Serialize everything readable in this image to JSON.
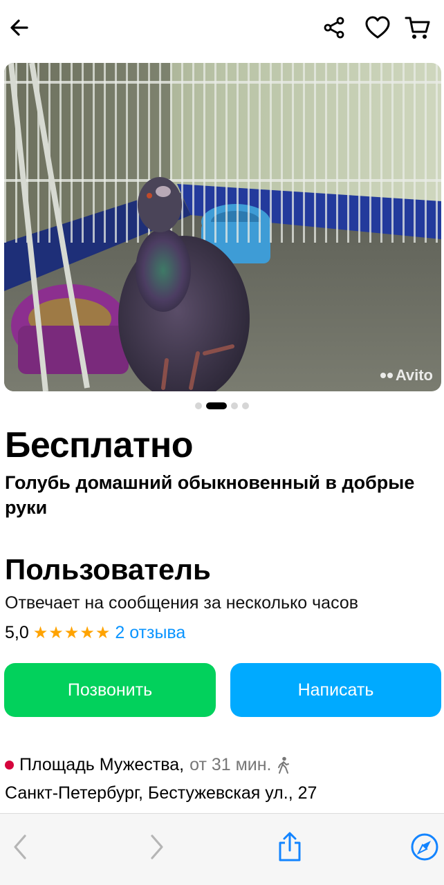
{
  "topbar": {
    "back_icon": "arrow-left-icon",
    "share_icon": "share-icon",
    "favorite_icon": "heart-icon",
    "cart_icon": "cart-icon"
  },
  "photo": {
    "watermark": "Avito",
    "carousel_total": 4,
    "carousel_active_index": 1
  },
  "listing": {
    "price": "Бесплатно",
    "title": "Голубь домашний обыкновенный в добрые руки"
  },
  "seller": {
    "name": "Пользователь",
    "reply_time": "Отвечает на сообщения за несколько часов",
    "rating": "5,0",
    "stars": "★★★★★",
    "stars_count": 5,
    "reviews": "2 отзыва"
  },
  "actions": {
    "call_label": "Позвонить",
    "write_label": "Написать"
  },
  "location": {
    "metro": "Площадь Мужества,",
    "distance": "от 31 мин.",
    "address": "Санкт-Петербург, Бестужевская ул., 27"
  },
  "browser": {
    "back_icon": "chevron-left-icon",
    "forward_icon": "chevron-right-icon",
    "share_icon": "share-up-icon",
    "compass_icon": "compass-icon"
  },
  "colors": {
    "call_button": "#02d15c",
    "write_button": "#00aaff",
    "stars": "#ffa300",
    "reviews_link": "#0a94ff",
    "metro_dot": "#d5043c"
  }
}
